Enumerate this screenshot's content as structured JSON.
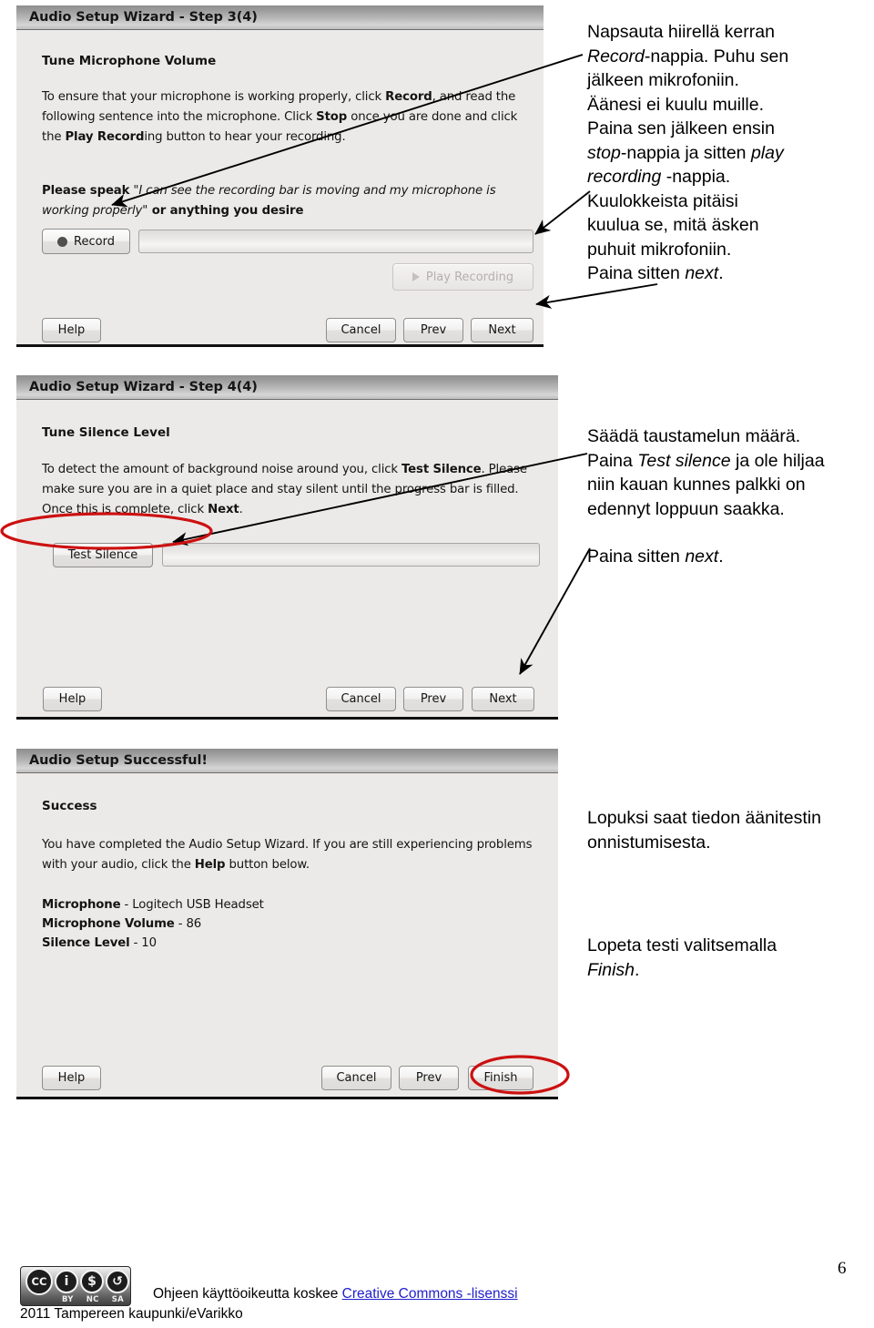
{
  "document": {
    "page_number": "6"
  },
  "dialogs": [
    {
      "title": "Audio Setup Wizard - Step 3(4)",
      "heading": "Tune Microphone Volume",
      "paragraph_line1": "To ensure that your microphone is working properly, click ",
      "paragraph_b1": "Record",
      "paragraph_line2": ", and read the following sentence into the microphone. Click ",
      "paragraph_b2": "Stop",
      "paragraph_line3": " once you are done and click the ",
      "paragraph_b3": "Play Record",
      "paragraph_line4": "ing button to hear your recording.",
      "speak_label": "Please speak",
      "speak_quote": "\"I can see the recording bar is moving and my microphone is working properly\"",
      "speak_tail": " or anything you desire",
      "record_button": "Record",
      "play_button": "Play Recording",
      "help_button": "Help",
      "cancel_button": "Cancel",
      "prev_button": "Prev",
      "next_button": "Next"
    },
    {
      "title": "Audio Setup Wizard - Step 4(4)",
      "heading": "Tune Silence Level",
      "paragraph_line1": "To detect the amount of background noise around you, click ",
      "paragraph_b1": "Test Silence",
      "paragraph_line2": ". Please make sure you are in a quiet place and stay silent until the progress bar is filled. Once this is complete, click ",
      "paragraph_b2": "Next",
      "paragraph_line3": ".",
      "test_silence_button": "Test Silence",
      "help_button": "Help",
      "cancel_button": "Cancel",
      "prev_button": "Prev",
      "next_button": "Next"
    },
    {
      "title": "Audio Setup Successful!",
      "heading": "Success",
      "paragraph_line1": "You have completed the Audio Setup Wizard. If you are still experiencing problems with your audio, click the ",
      "paragraph_b1": "Help",
      "paragraph_line2": " button below.",
      "summary": [
        {
          "label": "Microphone",
          "value": " - Logitech USB Headset"
        },
        {
          "label": "Microphone Volume",
          "value": " - 86"
        },
        {
          "label": "Silence Level",
          "value": " - 10"
        }
      ],
      "help_button": "Help",
      "cancel_button": "Cancel",
      "prev_button": "Prev",
      "finish_button": "Finish"
    }
  ],
  "notes": [
    {
      "lines": [
        {
          "plain": "Napsauta hiirellä kerran"
        },
        {
          "italic": "Record",
          "plain": "-nappia. Puhu sen"
        },
        {
          "plain": "jälkeen mikrofoniin."
        },
        {
          "plain": "Äänesi ei kuulu muille."
        },
        {
          "plain": "Paina sen jälkeen ensin"
        },
        {
          "italic": "stop",
          "plain": "-nappia ja sitten ",
          "italic2": "play"
        },
        {
          "italic": "recording",
          "plain": " -nappia."
        },
        {
          "plain": "Kuulokkeista pitäisi"
        },
        {
          "plain": "kuulua se, mitä äsken"
        },
        {
          "plain": "puhuit mikrofoniin."
        },
        {
          "plain": "Paina sitten ",
          "italic": "next",
          "plain2": "."
        }
      ]
    },
    {
      "lines": [
        {
          "plain": "Säädä taustamelun määrä."
        },
        {
          "plain": "Paina ",
          "italic": "Test silence",
          "plain2": " ja ole hiljaa"
        },
        {
          "plain": "niin kauan kunnes palkki on"
        },
        {
          "plain": "edennyt loppuun saakka."
        }
      ],
      "second": [
        {
          "plain": "Paina sitten ",
          "italic": "next",
          "plain2": "."
        }
      ]
    },
    {
      "lines": [
        {
          "plain": "Lopuksi saat tiedon äänitestin"
        },
        {
          "plain": "onnistumisesta."
        }
      ],
      "second": [
        {
          "plain": "Lopeta testi valitsemalla"
        },
        {
          "italic": "Finish",
          "plain": "."
        }
      ]
    }
  ],
  "note_text": {
    "n1_l1": "Napsauta hiirellä kerran",
    "n1_l2a": "Record",
    "n1_l2b": "-nappia. Puhu sen",
    "n1_l3": "jälkeen mikrofoniin.",
    "n1_l4": "Äänesi ei kuulu muille.",
    "n1_l5": "Paina sen jälkeen ensin",
    "n1_l6a": "stop",
    "n1_l6b": "-nappia ja sitten ",
    "n1_l6c": "play",
    "n1_l7a": "recording",
    "n1_l7b": " -nappia.",
    "n1_l8": "Kuulokkeista pitäisi",
    "n1_l9": "kuulua se, mitä äsken",
    "n1_l10": "puhuit mikrofoniin.",
    "n1_l11a": "Paina sitten ",
    "n1_l11b": "next",
    "n1_l11c": ".",
    "n2_l1": "Säädä taustamelun määrä.",
    "n2_l2a": "Paina ",
    "n2_l2b": "Test silence",
    "n2_l2c": " ja ole hiljaa",
    "n2_l3": "niin kauan kunnes palkki on",
    "n2_l4": "edennyt loppuun saakka.",
    "n2_l6a": "Paina sitten ",
    "n2_l6b": "next",
    "n2_l6c": ".",
    "n3_l1": "Lopuksi saat tiedon äänitestin",
    "n3_l2": "onnistumisesta.",
    "n3_l4": "Lopeta testi valitsemalla",
    "n3_l5a": "Finish",
    "n3_l5b": "."
  },
  "footer": {
    "cc_mark": "CC",
    "cc_by_glyph": "i",
    "cc_nc_glyph": "$",
    "cc_sa_glyph": "↺",
    "cc_labels": [
      "BY",
      "NC",
      "SA"
    ],
    "text_before_link": "Ohjeen käyttöoikeutta koskee ",
    "link_text": "Creative Commons -lisenssi",
    "line2": "2011 Tampereen kaupunki/eVarikko"
  },
  "colors": {
    "annotation_ellipse": "#cc1111",
    "link": "#2020cc",
    "titlebar_dark": "#8f8f8f",
    "dialog_bg": "#eceae8"
  }
}
